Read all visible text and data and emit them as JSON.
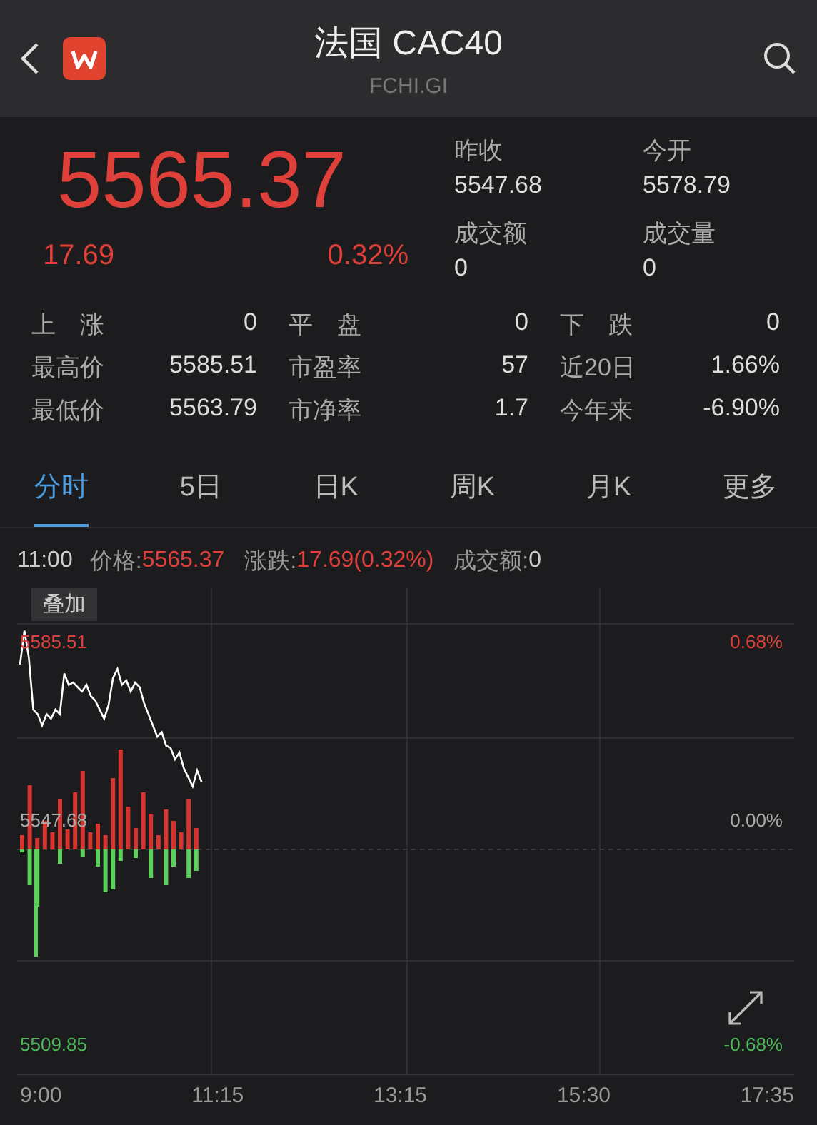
{
  "header": {
    "title": "法国 CAC40",
    "subtitle": "FCHI.GI"
  },
  "quote": {
    "price": "5565.37",
    "change": "17.69",
    "change_pct": "0.32%",
    "fields": [
      {
        "label": "昨收",
        "value": "5547.68"
      },
      {
        "label": "今开",
        "value": "5578.79"
      },
      {
        "label": "成交额",
        "value": "0"
      },
      {
        "label": "成交量",
        "value": "0"
      }
    ]
  },
  "stats": [
    {
      "label": "上　涨",
      "value": "0"
    },
    {
      "label": "平　盘",
      "value": "0"
    },
    {
      "label": "下　跌",
      "value": "0"
    },
    {
      "label": "最高价",
      "value": "5585.51"
    },
    {
      "label": "市盈率",
      "value": "57"
    },
    {
      "label": "近20日",
      "value": "1.66%"
    },
    {
      "label": "最低价",
      "value": "5563.79"
    },
    {
      "label": "市净率",
      "value": "1.7"
    },
    {
      "label": "今年来",
      "value": "-6.90%"
    }
  ],
  "tabs": [
    {
      "label": "分时",
      "selected": true
    },
    {
      "label": "5日",
      "selected": false
    },
    {
      "label": "日K",
      "selected": false
    },
    {
      "label": "周K",
      "selected": false
    },
    {
      "label": "月K",
      "selected": false
    },
    {
      "label": "更多",
      "selected": false
    }
  ],
  "info": {
    "time": "11:00",
    "price_label": "价格:",
    "price": "5565.37",
    "change_label": "涨跌:",
    "change": "17.69(0.32%)",
    "amount_label": "成交额:",
    "amount": "0"
  },
  "chart": {
    "overlay_button": "叠加",
    "high": "5585.51",
    "high_pct": "0.68%",
    "base": "5547.68",
    "base_pct": "0.00%",
    "low": "5509.85",
    "low_pct": "-0.68%",
    "times": [
      "9:00",
      "11:15",
      "13:15",
      "15:30",
      "17:35"
    ]
  }
}
